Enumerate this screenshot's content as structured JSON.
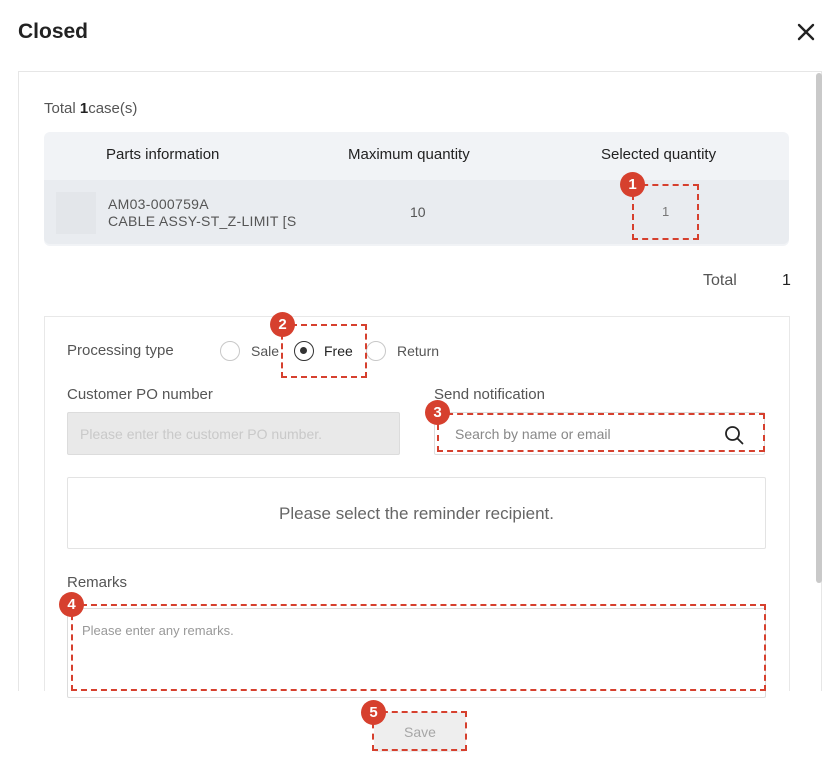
{
  "dialog": {
    "title": "Closed"
  },
  "summary": {
    "total_prefix": "Total ",
    "total_count": "1",
    "total_suffix": "case(s)"
  },
  "table": {
    "headers": [
      "Parts information",
      "Maximum quantity",
      "Selected quantity"
    ],
    "rows": [
      {
        "part_code": "AM03-000759A",
        "part_name": "CABLE ASSY-ST_Z-LIMIT [S",
        "max_quantity": "10",
        "selected_quantity": "1"
      }
    ]
  },
  "totals": {
    "label": "Total",
    "value": "1"
  },
  "form": {
    "processing_type_label": "Processing type",
    "processing_options": [
      {
        "label": "Sale",
        "selected": false
      },
      {
        "label": "Free",
        "selected": true
      },
      {
        "label": "Return",
        "selected": false
      }
    ],
    "customer_po_label": "Customer PO number",
    "customer_po_placeholder": "Please enter the customer PO number.",
    "notification_label": "Send notification",
    "notification_placeholder": "Search by name or email",
    "recipient_empty_text": "Please select the reminder recipient.",
    "remarks_label": "Remarks",
    "remarks_placeholder": "Please enter any remarks."
  },
  "actions": {
    "save_label": "Save"
  },
  "annotations": [
    "1",
    "2",
    "3",
    "4",
    "5"
  ],
  "colors": {
    "annotation": "#d6402e",
    "header_bg": "#f1f3f6",
    "row_bg": "#e9ecf0"
  },
  "icons": {
    "close": "close-icon",
    "search": "search-icon"
  }
}
